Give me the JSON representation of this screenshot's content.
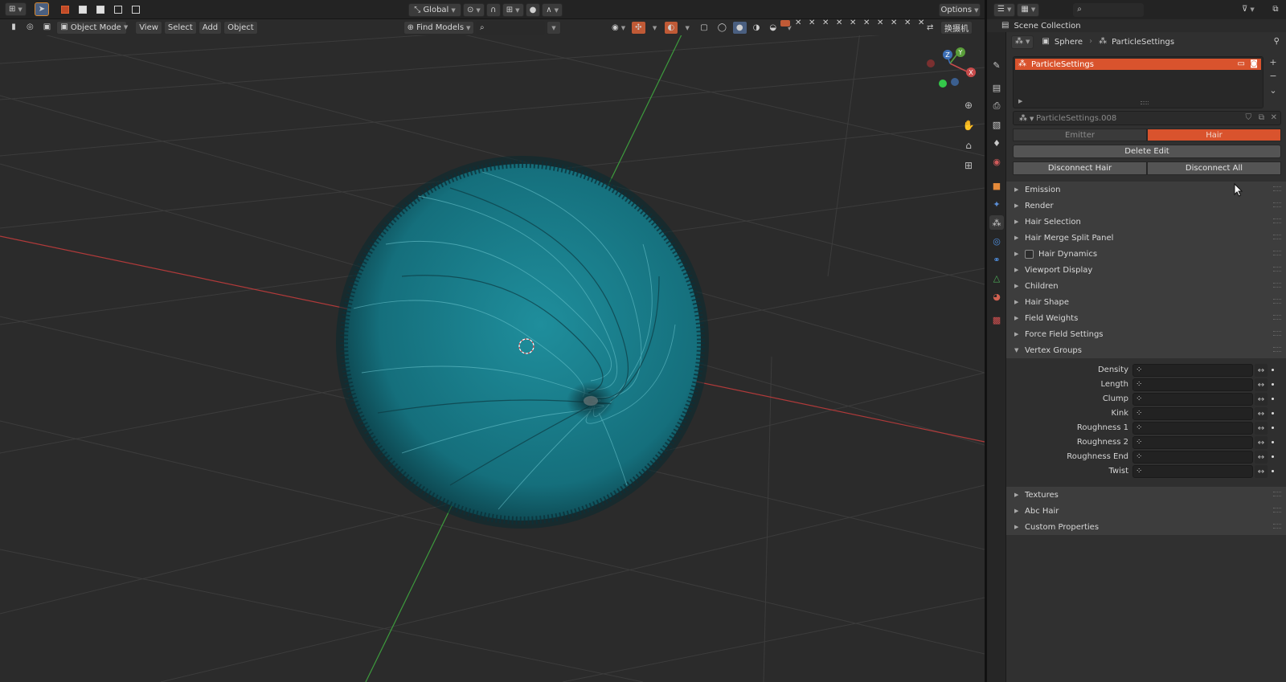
{
  "viewport": {
    "top": {
      "transform_orientation": "Global",
      "options_label": "Options"
    },
    "header": {
      "mode": "Object Mode",
      "menus": [
        "View",
        "Select",
        "Add",
        "Object"
      ],
      "find_models": "Find Models",
      "camera_label": "换摄机"
    }
  },
  "properties": {
    "scene_collection": "Scene Collection",
    "breadcrumb": {
      "object": "Sphere",
      "settings": "ParticleSettings"
    },
    "particle_system": "ParticleSettings",
    "settings_name": "ParticleSettings.008",
    "type_options": [
      "Emitter",
      "Hair"
    ],
    "delete_edit": "Delete Edit",
    "disconnect_hair": "Disconnect Hair",
    "disconnect_all": "Disconnect All",
    "panels_top": [
      {
        "label": "Emission"
      },
      {
        "label": "Render"
      },
      {
        "label": "Hair Selection"
      },
      {
        "label": "Hair Merge Split Panel"
      },
      {
        "label": "Hair Dynamics"
      },
      {
        "label": "Viewport Display"
      },
      {
        "label": "Children"
      },
      {
        "label": "Hair Shape"
      },
      {
        "label": "Field Weights"
      },
      {
        "label": "Force Field Settings"
      },
      {
        "label": "Vertex Groups"
      }
    ],
    "vertex_groups": [
      "Density",
      "Length",
      "Clump",
      "Kink",
      "Roughness 1",
      "Roughness 2",
      "Roughness End",
      "Twist"
    ],
    "panels_bottom": [
      {
        "label": "Textures"
      },
      {
        "label": "Abc Hair"
      },
      {
        "label": "Custom Properties"
      }
    ]
  },
  "colors": {
    "accent": "#d9532d",
    "hair": "#1d8a98",
    "x_axis": "#b03a3a",
    "y_axis": "#3d9b3d"
  }
}
